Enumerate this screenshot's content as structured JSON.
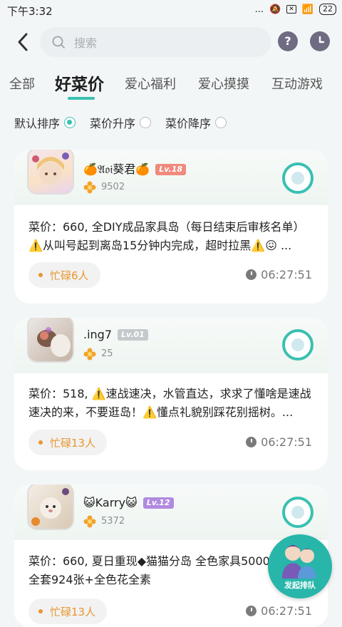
{
  "status_bar": {
    "time": "下午3:32",
    "signal": "...",
    "battery": "22"
  },
  "header": {
    "search_placeholder": "搜索",
    "help_label": "?",
    "icons": [
      "back-icon",
      "search-icon",
      "help-icon",
      "history-clock-icon"
    ]
  },
  "tabs": [
    {
      "label": "全部",
      "active": false
    },
    {
      "label": "好菜价",
      "active": true
    },
    {
      "label": "爱心福利",
      "active": false
    },
    {
      "label": "爱心摸摸",
      "active": false
    },
    {
      "label": "互动游戏",
      "active": false
    }
  ],
  "sort": {
    "options": [
      {
        "label": "默认排序",
        "selected": true
      },
      {
        "label": "菜价升序",
        "selected": false
      },
      {
        "label": "菜价降序",
        "selected": false
      }
    ]
  },
  "posts": [
    {
      "username": "🍊𝔄𝔬𝔦葵君🍊",
      "level": "Lv.18",
      "level_color": "#ef8a7d",
      "flowers": "9502",
      "text": "菜价：660, 全DIY成品家具岛（每日结束后审核名单）⚠️从叫号起到离岛15分钟内完成，超时拉黑⚠️😖 ...",
      "status": "忙碌6人",
      "time": "06:27:51"
    },
    {
      "username": ".ing7",
      "level": "Lv.01",
      "level_color": "#c5c9cc",
      "flowers": "25",
      "text": "菜价：518, ⚠️速战速决，水管直达，求求了懂啥是速战速决的来，不要逛岛！⚠️懂点礼貌别踩花别摇树。...",
      "status": "忙碌13人",
      "time": "06:27:51"
    },
    {
      "username": "😺Karry😺",
      "level": "Lv.12",
      "level_color": "#b08ae0",
      "flowers": "5372",
      "text": "菜价：660, 夏日重现◆猫猫分岛 全色家具5000件+DIY全套924张+全色花全素",
      "status": "忙碌13人",
      "time": "06:27:51"
    }
  ],
  "fab": {
    "label": "发起排队"
  },
  "colors": {
    "accent": "#39c0b2",
    "busy": "#e8962e",
    "background": "#f3f6f7"
  }
}
